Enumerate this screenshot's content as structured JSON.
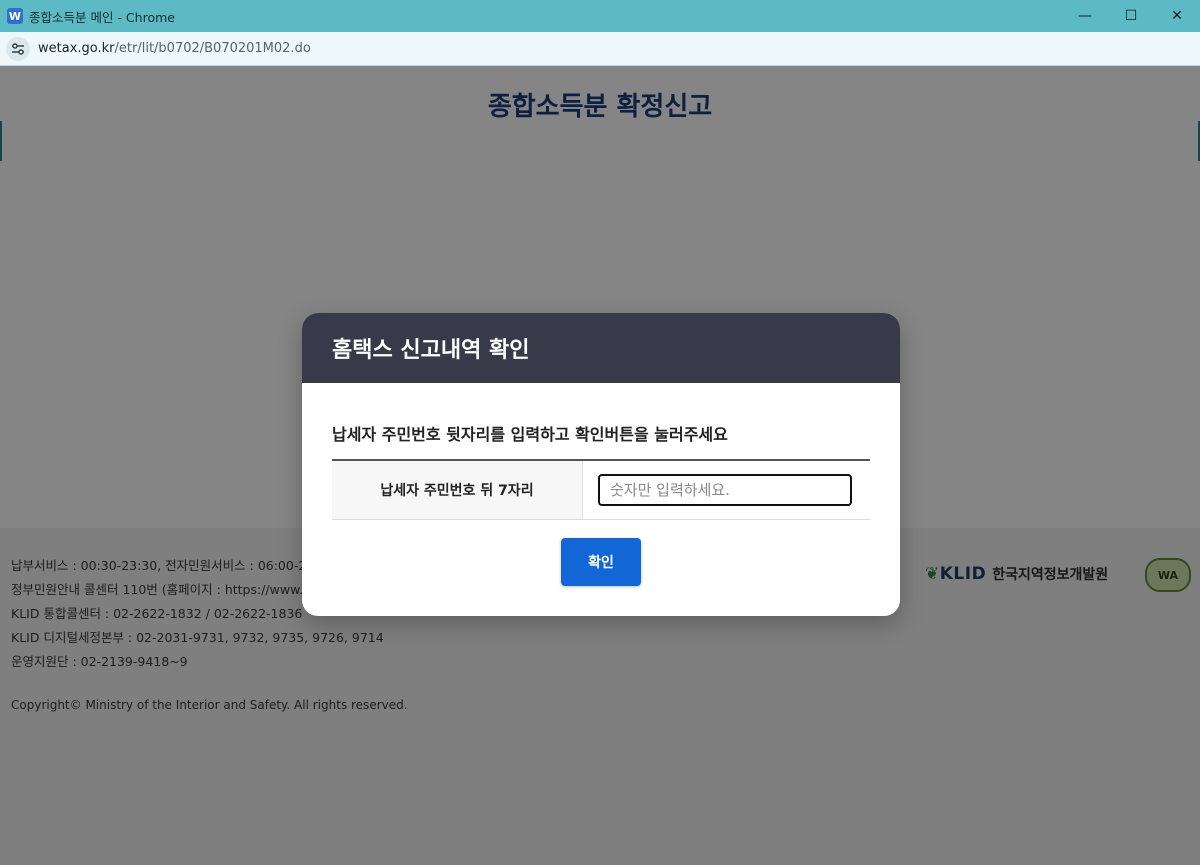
{
  "window": {
    "title": "종합소득분 메인 - Chrome",
    "app_icon_letter": "W",
    "controls": {
      "minimize": "—",
      "maximize": "☐",
      "close": "✕"
    }
  },
  "address_bar": {
    "host": "wetax.go.kr",
    "path": "/etr/lit/b0702/B070201M02.do",
    "site_icon": "tune-icon"
  },
  "page": {
    "title": "종합소득분 확정신고"
  },
  "footer": {
    "lines": [
      "납부서비스 : 00:30-23:30, 전자민원서비스 : 06:00-24:00",
      "정부민원안내 콜센터 110번 (홈페이지 : https://www.1",
      "KLID 통합콜센터 : 02-2622-1832 / 02-2622-1836",
      "KLID 디지털세정본부 : 02-2031-9731, 9732, 9735, 9726, 9714",
      "운영지원단 : 02-2139-9418~9"
    ],
    "copyright": "Copyright© Ministry of the Interior and Safety. All rights reserved.",
    "klid_logo": "KLID",
    "klid_name": "한국지역정보개발원",
    "wa_mark": "WA"
  },
  "modal": {
    "title": "홈택스 신고내역 확인",
    "instruction": "납세자 주민번호 뒷자리를 입력하고 확인버튼을 눌러주세요",
    "field_label": "납세자 주민번호 뒤 7자리",
    "input": {
      "value": "",
      "placeholder": "숫자만 입력하세요."
    },
    "confirm_label": "확인"
  }
}
